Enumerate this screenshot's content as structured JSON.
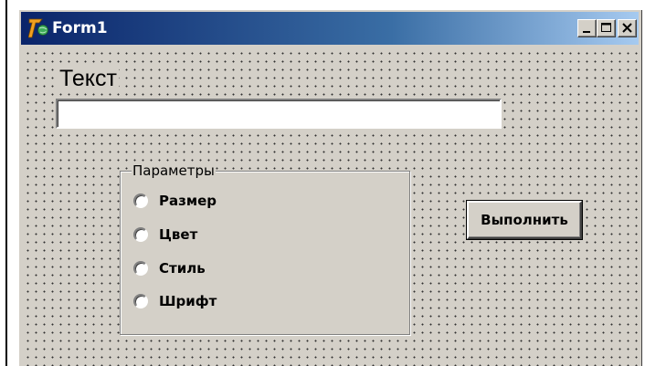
{
  "window": {
    "title": "Form1",
    "title_icon": "delphi-app-icon",
    "controls": [
      "minimize-icon",
      "maximize-icon",
      "close-icon"
    ]
  },
  "form": {
    "label": "Текст",
    "text_input": {
      "value": "",
      "placeholder": ""
    },
    "group": {
      "caption": "Параметры",
      "options": [
        {
          "label": "Размер",
          "checked": false
        },
        {
          "label": "Цвет",
          "checked": false
        },
        {
          "label": "Стиль",
          "checked": false
        },
        {
          "label": "Шрифт",
          "checked": false
        }
      ]
    },
    "execute_button": "Выполнить"
  },
  "colors": {
    "face": "#d4d0c8",
    "titlebar_start": "#0a246a",
    "titlebar_end": "#a6caf0"
  }
}
